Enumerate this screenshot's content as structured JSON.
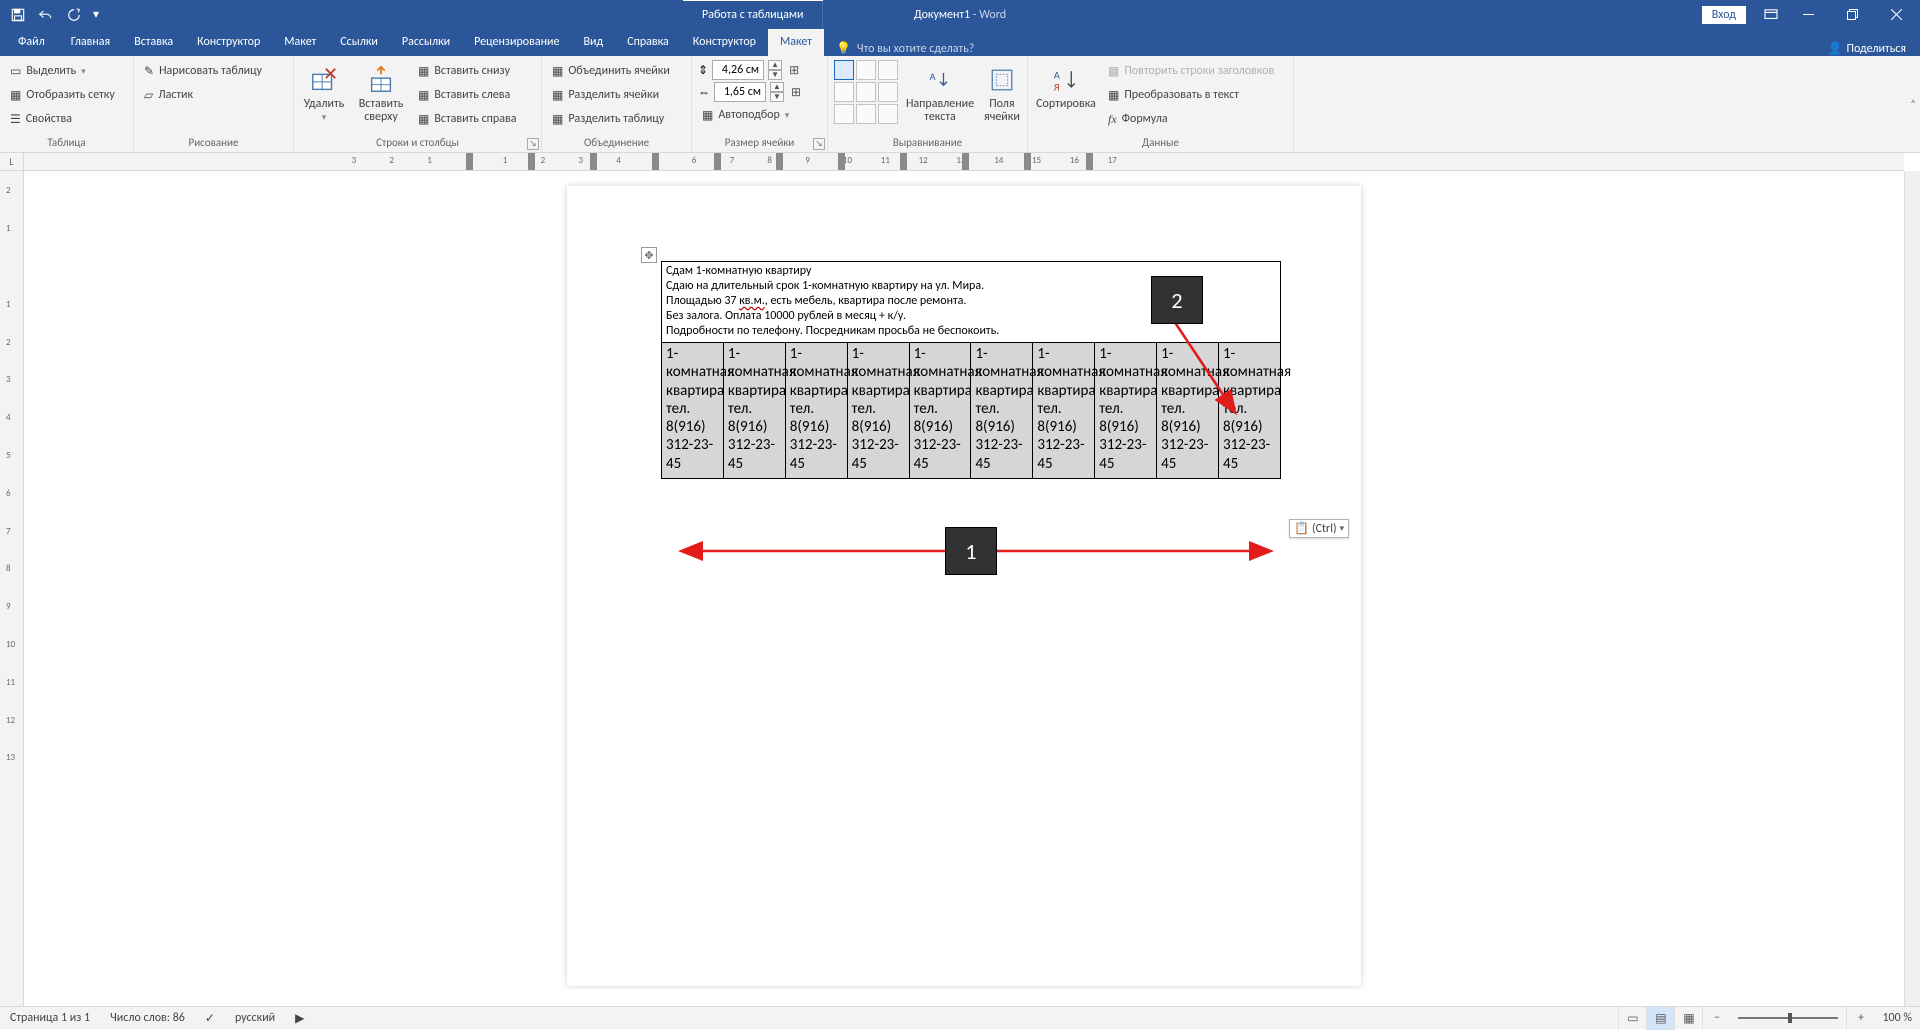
{
  "titlebar": {
    "doc_name": "Документ1",
    "app_name": " - Word",
    "context_tab": "Работа с таблицами",
    "login": "Вход"
  },
  "tabs": {
    "file": "Файл",
    "home": "Главная",
    "insert": "Вставка",
    "design": "Конструктор",
    "layout": "Макет",
    "refs": "Ссылки",
    "mail": "Рассылки",
    "review": "Рецензирование",
    "view": "Вид",
    "help": "Справка",
    "tbl_design": "Конструктор",
    "tbl_layout": "Макет",
    "tellme": "Что вы хотите сделать?",
    "share": "Поделиться"
  },
  "ribbon": {
    "table_group": "Таблица",
    "select": "Выделить",
    "gridlines": "Отобразить сетку",
    "properties": "Свойства",
    "draw_group": "Рисование",
    "draw_table": "Нарисовать таблицу",
    "eraser": "Ластик",
    "rows_cols_group": "Строки и столбцы",
    "delete": "Удалить",
    "insert_above": "Вставить сверху",
    "insert_below": "Вставить снизу",
    "insert_left": "Вставить слева",
    "insert_right": "Вставить справа",
    "merge_group": "Объединение",
    "merge_cells": "Объединить ячейки",
    "split_cells": "Разделить ячейки",
    "split_table": "Разделить таблицу",
    "size_group": "Размер ячейки",
    "height_val": "4,26 см",
    "width_val": "1,65 см",
    "autofit": "Автоподбор",
    "align_group": "Выравнивание",
    "text_dir": "Направление текста",
    "cell_margins": "Поля ячейки",
    "data_group": "Данные",
    "sort": "Сортировка",
    "repeat_header": "Повторить строки заголовков",
    "convert": "Преобразовать в текст",
    "formula": "Формула"
  },
  "ruler": {
    "h_nums": [
      "3",
      "2",
      "1",
      "1",
      "2",
      "3",
      "4",
      "5",
      "6",
      "7",
      "8",
      "9",
      "10",
      "11",
      "12",
      "13",
      "14",
      "15",
      "16",
      "17"
    ],
    "v_nums": [
      "2",
      "1",
      "1",
      "2",
      "3",
      "4",
      "5",
      "6",
      "7",
      "8",
      "9",
      "10",
      "11",
      "12",
      "13"
    ]
  },
  "document": {
    "header_lines": [
      "Сдам 1-комнатную квартиру",
      "Сдаю на длительный срок 1-комнатную квартиру на ул. Мира.",
      "Площадью 37 кв.м., есть мебель, квартира после ремонта.",
      "Без залога. Оплата 10000 рублей в месяц + к/у.",
      "Подробности по телефону. Посредникам просьба не беспокоить."
    ],
    "wavy_token": "кв.м.",
    "tear_text": "1-комнатная квартира\nтел. 8(916) 312-23-45",
    "tear_count": 10,
    "paste_tag": "(Ctrl)",
    "annot_1": "1",
    "annot_2": "2"
  },
  "statusbar": {
    "page": "Страница 1 из 1",
    "words": "Число слов: 86",
    "lang": "русский",
    "zoom": "100 %"
  }
}
